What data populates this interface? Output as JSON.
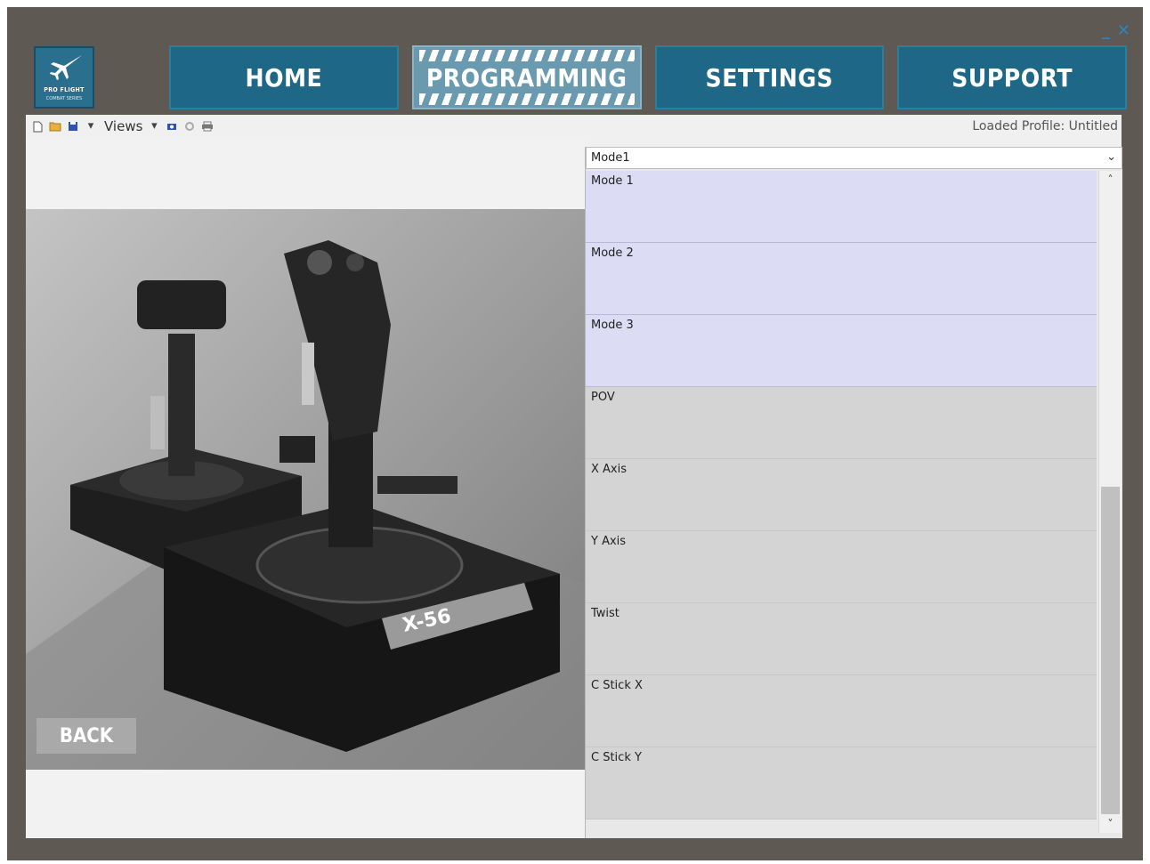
{
  "app": {
    "logo_text": "PRO FLIGHT",
    "logo_sub": "COMBAT SERIES"
  },
  "window_controls": {
    "minimize": "_",
    "close": "✕"
  },
  "nav": {
    "tabs": [
      {
        "label": "HOME",
        "active": false
      },
      {
        "label": "PROGRAMMING",
        "active": true
      },
      {
        "label": "SETTINGS",
        "active": false
      },
      {
        "label": "SUPPORT",
        "active": false
      }
    ]
  },
  "toolbar": {
    "views_label": "Views",
    "views_arrow": "▾",
    "loaded_profile": "Loaded Profile: Untitled",
    "icons": [
      "new-file-icon",
      "open-folder-icon",
      "save-icon",
      "save-dropdown-icon",
      "views-dropdown-icon",
      "camera-icon",
      "settings-icon",
      "print-icon"
    ]
  },
  "preview": {
    "back_label": "BACK",
    "product_label": "X-56"
  },
  "mode_select": {
    "value": "Mode1",
    "chevron": "⌄"
  },
  "list": {
    "rows": [
      {
        "label": "Mode 1",
        "kind": "mode"
      },
      {
        "label": "Mode 2",
        "kind": "mode"
      },
      {
        "label": "Mode 3",
        "kind": "mode"
      },
      {
        "label": "POV",
        "kind": "axis"
      },
      {
        "label": "X Axis",
        "kind": "axis"
      },
      {
        "label": "Y Axis",
        "kind": "axis"
      },
      {
        "label": "Twist",
        "kind": "axis"
      },
      {
        "label": "C Stick X",
        "kind": "axis"
      },
      {
        "label": "C Stick Y",
        "kind": "axis"
      }
    ]
  },
  "scrollbar": {
    "up": "˄",
    "down": "˅"
  },
  "colors": {
    "nav_tab": "#1f6787",
    "nav_active": "#6a9ab0",
    "frame": "#5e5a53",
    "mode_row": "#dcdcf5",
    "axis_row": "#d4d4d4"
  }
}
